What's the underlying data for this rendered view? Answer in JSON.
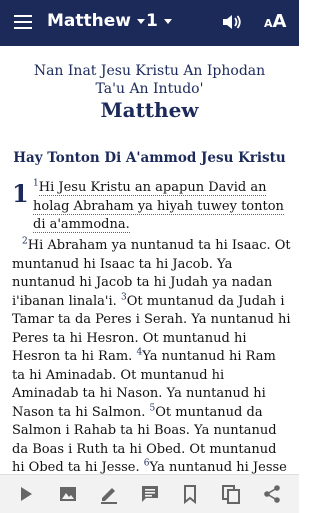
{
  "appbar": {
    "book": "Matthew",
    "chapter": "1",
    "font_small": "A",
    "font_big": "A"
  },
  "main_title": {
    "line1": "Nan Inat Jesu Kristu An Iphodan",
    "line2": "Ta'u An Intudo'",
    "book": "Matthew"
  },
  "section_heading": "Hay Tonton Di A'ammod Jesu Kristu",
  "chapter_number": "1",
  "verses": {
    "v1_num": "1",
    "v1_text": "Hi Jesu Kristu an apapun David an holag Abraham ya hiyah tuwey tonton di a'ammodna.",
    "v2_num": "2",
    "v2_text": "Hi Abraham ya nuntanud ta hi Isaac. Ot muntanud hi Isaac ta hi Jacob. Ya nuntanud hi Jacob ta hi Judah ya nadan i'ibanan linala'i.",
    "v3_num": "3",
    "v3_text": "Ot muntanud da Judah i Tamar ta da Peres i Serah. Ya nuntanud hi Peres ta hi Hesron. Ot muntanud hi Hesron ta hi Ram.",
    "v4_num": "4",
    "v4_text": "Ya nuntanud hi Ram ta hi Aminadab. Ot muntanud hi Aminadab ta hi Nason. Ya nuntanud hi Nason ta hi Salmon.",
    "v5_num": "5",
    "v5_text": "Ot muntanud da Salmon i Rahab ta hi Boas. Ya nuntanud da Boas i Ruth ta hi Obed. Ot muntanud hi Obed ta hi Jesse.",
    "v6_num": "6",
    "v6_text": "Ya nuntanud hi Jesse ta hon patul an hi David."
  },
  "bottom_bar": {
    "icons": [
      "play-icon",
      "image-icon",
      "edit-icon",
      "comment-icon",
      "bookmark-icon",
      "copy-icon",
      "share-icon"
    ]
  }
}
